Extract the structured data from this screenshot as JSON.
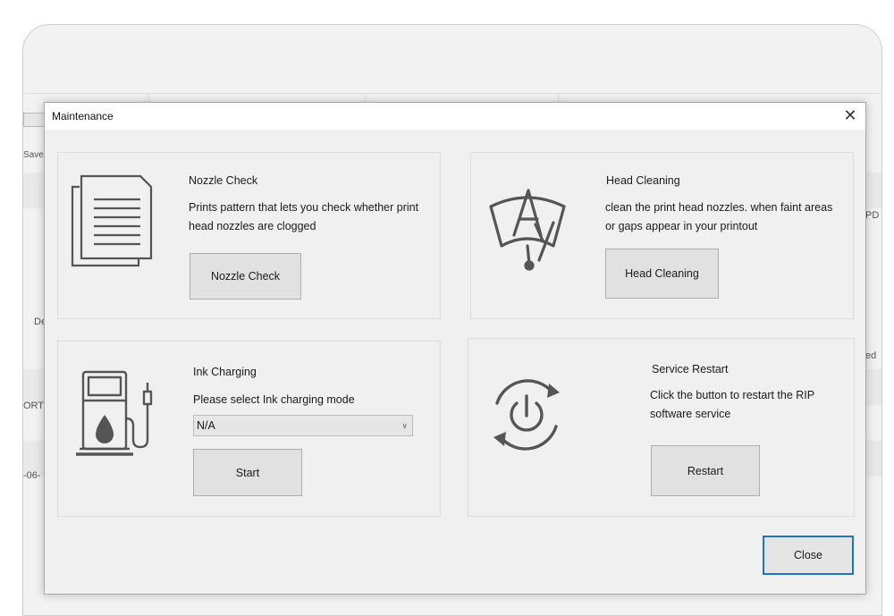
{
  "background_app": {
    "save_label": "Save",
    "row_fragment_1": "De",
    "row_fragment_2": "ORTE",
    "row_fragment_3": "-06-",
    "right_fragment_1": "PD",
    "right_fragment_2": "ed"
  },
  "dialog": {
    "title": "Maintenance",
    "close_glyph": "✕",
    "close_button_label": "Close"
  },
  "nozzle_check": {
    "title": "Nozzle Check",
    "description": "Prints pattern that lets you check whether print head nozzles are clogged",
    "button_label": "Nozzle Check",
    "icon": "document-pages-icon"
  },
  "head_cleaning": {
    "title": "Head Cleaning",
    "description": "clean the print head nozzles.  when faint areas or gaps appear in your printout",
    "button_label": "Head Cleaning",
    "icon": "print-head-cleaning-icon"
  },
  "ink_charging": {
    "title": "Ink Charging",
    "description": "Please select Ink charging mode",
    "mode_selected": "N/A",
    "button_label": "Start",
    "icon": "ink-pump-icon"
  },
  "service_restart": {
    "title": "Service Restart",
    "description": "Click the button to restart the RIP software service",
    "button_label": "Restart",
    "icon": "power-restart-icon"
  },
  "colors": {
    "dialog_bg": "#f0f0f0",
    "button_bg": "#e1e1e1",
    "default_button_border": "#1f74c9",
    "icon_stroke": "#555555"
  }
}
